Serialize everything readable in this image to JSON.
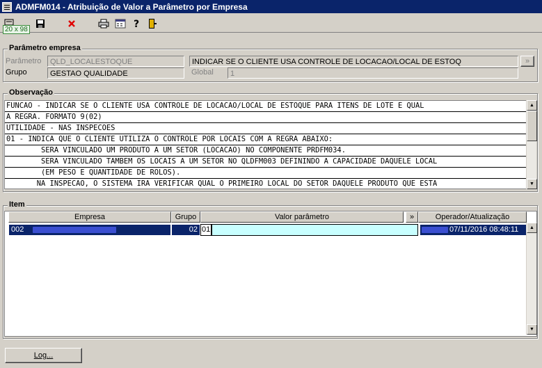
{
  "window": {
    "title": "ADMFM014 - Atribuição de Valor a Parâmetro por Empresa"
  },
  "toolbar": {
    "size_badge": "20 x 98",
    "icons": [
      "list-icon",
      "save-icon",
      "delete-icon",
      "print-icon",
      "calculator-icon",
      "help-icon",
      "exit-icon"
    ],
    "delete_color": "#e00000"
  },
  "parametro_empresa": {
    "title": "Parâmetro empresa",
    "parametro_label": "Parâmetro",
    "parametro_code": "QLD_LOCALESTOQUE",
    "parametro_desc": "INDICAR SE O CLIENTE USA CONTROLE DE LOCACAO/LOCAL DE ESTOQ",
    "lookup_button": "»",
    "grupo_label": "Grupo",
    "grupo_value": "GESTAO QUALIDADE",
    "global_label": "Global",
    "global_value": "1"
  },
  "observacao": {
    "title": "Observação",
    "lines": [
      "FUNCAO - INDICAR SE O CLIENTE USA CONTROLE DE LOCACAO/LOCAL DE ESTOQUE PARA ITENS DE LOTE E QUAL",
      "A REGRA. FORMATO 9(02)",
      "UTILIDADE - NAS INSPECOES",
      "01 - INDICA QUE O CLIENTE UTILIZA O CONTROLE POR LOCAIS COM A REGRA ABAIXO:",
      "        SERA VINCULADO UM PRODUTO A UM SETOR (LOCACAO) NO COMPONENTE PRDFM034.",
      "        SERA VINCULADO TAMBEM OS LOCAIS A UM SETOR NO QLDFM003 DEFININDO A CAPACIDADE DAQUELE LOCAL",
      "        (EM PESO E QUANTIDADE DE ROLOS).",
      "       NA INSPECAO, O SISTEMA IRA VERIFICAR QUAL O PRIMEIRO LOCAL DO SETOR DAQUELE PRODUTO QUE ESTA"
    ]
  },
  "item": {
    "title": "Item",
    "columns": [
      "Empresa",
      "Grupo",
      "Valor parâmetro",
      "»",
      "Operador/Atualização"
    ],
    "rows": [
      {
        "empresa_code": "002",
        "grupo": "02",
        "valor": "01",
        "atualizacao": "07/11/2016 08:48:11"
      }
    ]
  },
  "footer": {
    "log_button": "Log..."
  },
  "colors": {
    "titlebar": "#0a246a",
    "selection": "#0a246a",
    "valor_cell": "#c8ffff"
  }
}
